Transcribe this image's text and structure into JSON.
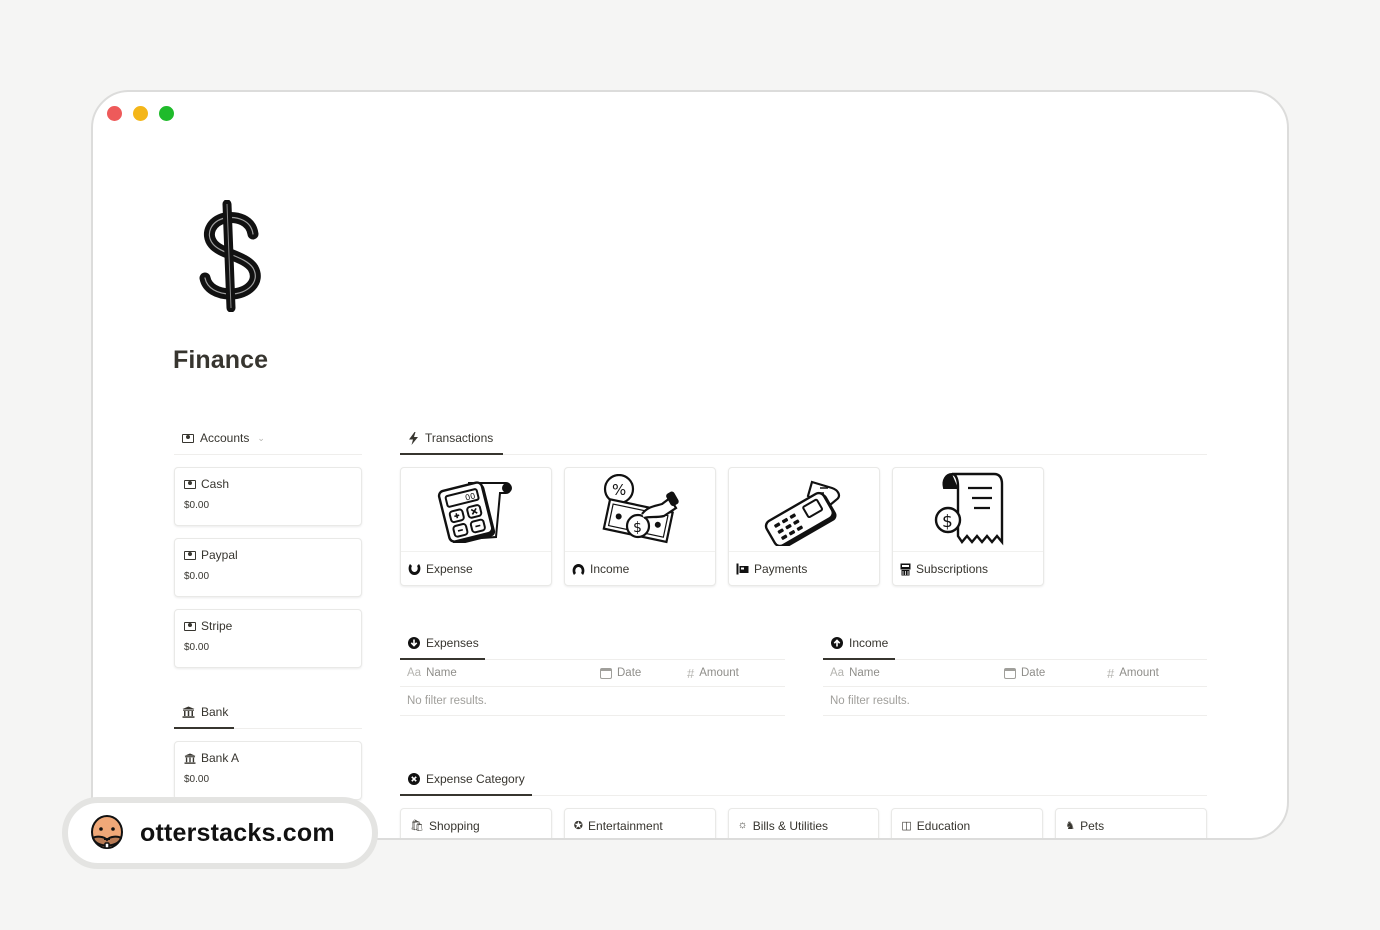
{
  "window": {
    "controls": [
      "close",
      "minimize",
      "maximize"
    ]
  },
  "page": {
    "icon": "dollar-sign-icon",
    "title": "Finance"
  },
  "accounts": {
    "tab_label": "Accounts",
    "items": [
      {
        "name": "Cash",
        "value": "$0.00",
        "icon": "money-icon"
      },
      {
        "name": "Paypal",
        "value": "$0.00",
        "icon": "money-icon"
      },
      {
        "name": "Stripe",
        "value": "$0.00",
        "icon": "money-icon"
      }
    ]
  },
  "bank": {
    "tab_label": "Bank",
    "items": [
      {
        "name": "Bank A",
        "value": "$0.00",
        "icon": "bank-icon"
      }
    ]
  },
  "transactions": {
    "tab_label": "Transactions",
    "cards": [
      {
        "label": "Expense",
        "icon": "expense-icon",
        "cover": "calculator-illustration"
      },
      {
        "label": "Income",
        "icon": "income-icon",
        "cover": "money-hand-illustration"
      },
      {
        "label": "Payments",
        "icon": "payments-icon",
        "cover": "card-terminal-illustration"
      },
      {
        "label": "Subscriptions",
        "icon": "subscriptions-icon",
        "cover": "receipt-illustration"
      }
    ]
  },
  "expenses": {
    "tab_label": "Expenses",
    "columns": [
      {
        "prefix": "Aa",
        "label": "Name"
      },
      {
        "prefix": "calendar",
        "label": "Date"
      },
      {
        "prefix": "#",
        "label": "Amount"
      }
    ],
    "empty_text": "No filter results."
  },
  "income": {
    "tab_label": "Income",
    "columns": [
      {
        "prefix": "Aa",
        "label": "Name"
      },
      {
        "prefix": "calendar",
        "label": "Date"
      },
      {
        "prefix": "#",
        "label": "Amount"
      }
    ],
    "empty_text": "No filter results."
  },
  "expense_category": {
    "tab_label": "Expense Category",
    "items": [
      {
        "label": "Shopping",
        "icon": "shopping-icon"
      },
      {
        "label": "Entertainment",
        "icon": "entertainment-icon"
      },
      {
        "label": "Bills & Utilities",
        "icon": "bills-icon"
      },
      {
        "label": "Education",
        "icon": "education-icon"
      },
      {
        "label": "Pets",
        "icon": "pets-icon"
      }
    ]
  },
  "watermark": {
    "text": "otterstacks.com",
    "icon": "otter-icon"
  }
}
